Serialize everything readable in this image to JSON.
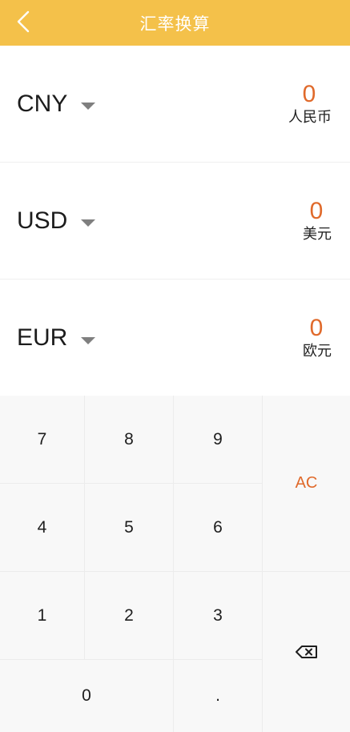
{
  "header": {
    "title": "汇率换算"
  },
  "currencies": [
    {
      "code": "CNY",
      "value": "0",
      "name": "人民币"
    },
    {
      "code": "USD",
      "value": "0",
      "name": "美元"
    },
    {
      "code": "EUR",
      "value": "0",
      "name": "欧元"
    }
  ],
  "keypad": {
    "k7": "7",
    "k8": "8",
    "k9": "9",
    "k4": "4",
    "k5": "5",
    "k6": "6",
    "k1": "1",
    "k2": "2",
    "k3": "3",
    "k0": "0",
    "dot": ".",
    "clear": "AC"
  },
  "colors": {
    "header_bg": "#f4c14a",
    "accent": "#e06a2b"
  },
  "icons": {
    "back": "chevron-left-icon",
    "dropdown": "caret-down-icon",
    "delete": "backspace-icon"
  }
}
